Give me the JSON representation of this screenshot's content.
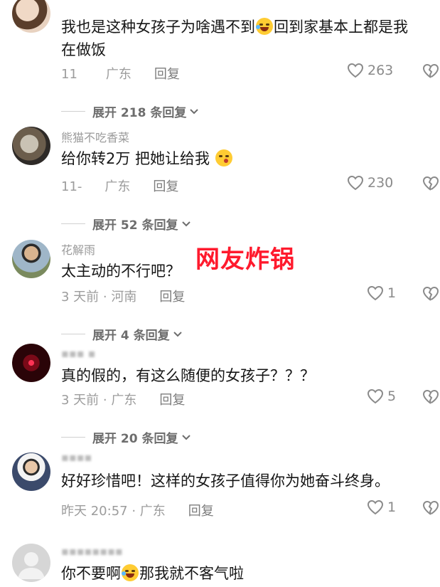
{
  "watermark": "网友炸锅",
  "colors": {
    "watermark": "#ff1a2d",
    "meta": "#9c9c9c",
    "text": "#161616"
  },
  "comments": [
    {
      "username": "",
      "text_a": "我也是这种女孩子为啥遇不到",
      "text_b": "回到家基本上都是我在做饭",
      "emoji": "laughing-tears-emoji",
      "time": "11",
      "location": "广东",
      "reply": "回复",
      "likes": "263"
    },
    {
      "expand": "展开 218 条回复",
      "username": "熊猫不吃香菜",
      "text_a": "给你转2万 把她让给我",
      "emoji": "kissing-emoji",
      "time": "11-",
      "location": "广东",
      "reply": "回复",
      "likes": "230"
    },
    {
      "expand": "展开 52 条回复",
      "username": "花解雨",
      "text_a": "太主动的不行吧？",
      "time": "3 天前 · 河南",
      "reply": "回复",
      "likes": "1"
    },
    {
      "expand": "展开 4 条回复",
      "username": "",
      "text_a": "真的假的，有这么随便的女孩子？？？",
      "time": "3 天前 · 广东",
      "reply": "回复",
      "likes": "5"
    },
    {
      "expand": "展开 20 条回复",
      "username": "",
      "text_a": "好好珍惜吧！这样的女孩子值得你为她奋斗终身。",
      "time": "昨天 20:57 · 广东",
      "reply": "回复",
      "likes": "1"
    },
    {
      "username": "",
      "text_a": "你不要啊",
      "text_b": "那我就不客气啦",
      "emoji": "laughing-tears-emoji"
    }
  ]
}
